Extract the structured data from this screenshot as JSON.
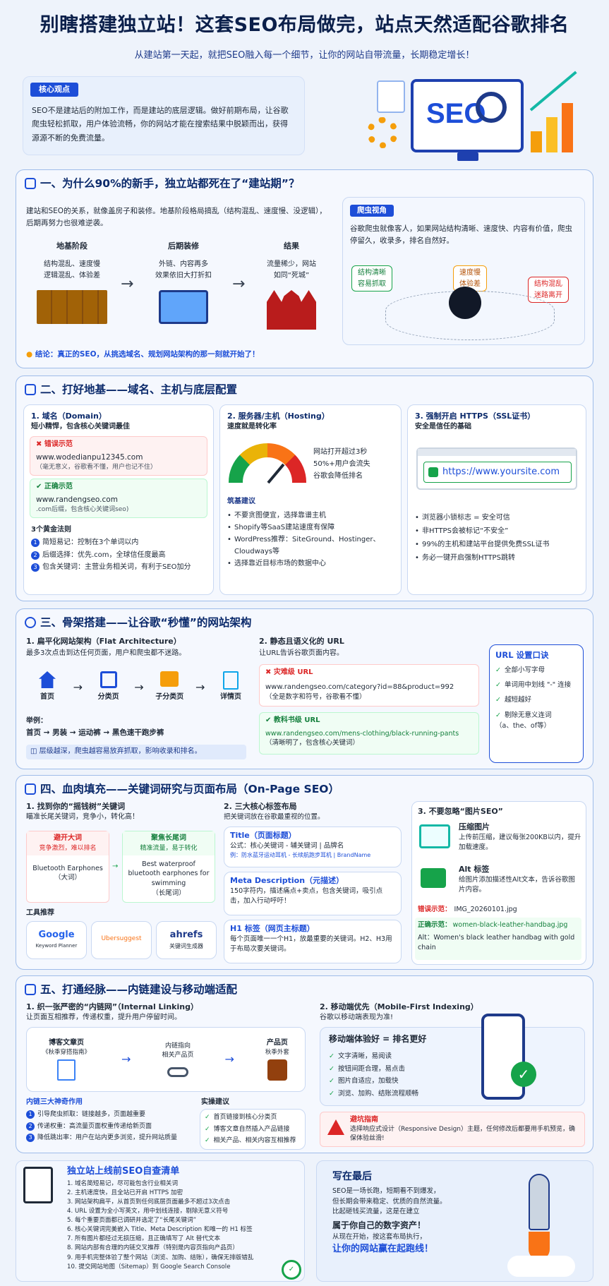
{
  "header": {
    "title": "别瞎搭建独立站！这套SEO布局做完，站点天然适配谷歌排名",
    "subtitle": "从建站第一天起，就把SEO融入每一个细节，让你的网站自带流量，长期稳定增长！"
  },
  "core": {
    "tag": "核心观点",
    "text": "SEO不是建站后的附加工作，而是建站的底层逻辑。做好前期布局，让谷歌爬虫轻松抓取，用户体验流畅，你的网站才能在搜索结果中脱颖而出，获得源源不断的免费流量。",
    "hero_text": "SEO"
  },
  "s1": {
    "title": "一、为什么90%的新手，独立站都死在了“建站期”？",
    "intro": "建站和SEO的关系，就像盖房子和装修。地基阶段格局搞乱（结构混乱、速度慢、没逻辑），后期再努力也很难逆袭。",
    "stages": [
      {
        "title": "地基阶段",
        "desc": "结构混乱、速度慢\n逻辑混乱、体验差"
      },
      {
        "title": "后期装修",
        "desc": "外链、内容再多\n效果依旧大打折扣"
      },
      {
        "title": "结果",
        "desc": "流量稀少，网站\n如同“死城”"
      }
    ],
    "crawler_tag": "爬虫视角",
    "crawler_text": "谷歌爬虫就像客人，如果网站结构清晰、速度快、内容有价值，爬虫停留久，收录多，排名自然好。",
    "bubbles": [
      "结构清晰\n容易抓取",
      "速度慢\n体验差",
      "结构混乱\n迷路离开"
    ],
    "conclusion": "结论：真正的SEO，从挑选域名、规划网站架构的那一刻就开始了！"
  },
  "s2": {
    "title": "二、打好地基——域名、主机与底层配置",
    "c1": {
      "title": "1. 域名（Domain）",
      "sub": "短小精悍，包含核心关键词最佳",
      "bad_label": "错误示范",
      "bad_url": "www.wodedianpu12345.com",
      "bad_note": "（毫无意义，谷歌看不懂，用户也记不住）",
      "good_label": "正确示范",
      "good_url": "www.randengseo.com",
      "good_note": ".com后缀，包含核心关键词seo)",
      "rules_title": "3个黄金法则",
      "rules": [
        "简短易记：控制在3个单词以内",
        "后缀选择：优先.com，全球信任度最高",
        "包含关键词：主营业务相关词，有利于SEO加分"
      ]
    },
    "c2": {
      "title": "2. 服务器/主机（Hosting）",
      "sub": "速度就是转化率",
      "gauge_text": "网站打开超过3秒\n50%+用户会流失\n谷歌会降低排名",
      "tips_title": "筑基建议",
      "tips": [
        "不要贪图便宜，选择靠谱主机",
        "Shopify等SaaS建站速度有保障",
        "WordPress推荐：SiteGround、Hostinger、Cloudways等",
        "选择靠近目标市场的数据中心"
      ]
    },
    "c3": {
      "title": "3. 强制开启 HTTPS（SSL证书）",
      "sub": "安全是信任的基础",
      "url": "https://www.yoursite.com",
      "tips": [
        "浏览器小锁标志 = 安全可信",
        "非HTTPS会被标记“不安全”",
        "99%的主机和建站平台提供免费SSL证书",
        "务必一键开启强制HTTPS跳转"
      ]
    }
  },
  "s3": {
    "title": "三、骨架搭建——让谷歌“秒懂”的网站架构",
    "c1": {
      "title": "1. 扁平化网站架构（Flat Architecture）",
      "sub": "最多3次点击到达任何页面，用户和爬虫都不迷路。",
      "nodes": [
        "首页",
        "分类页",
        "子分类页",
        "详情页"
      ],
      "example_label": "举例：",
      "example": [
        "首页",
        "男装",
        "运动裤",
        "黑色速干跑步裤"
      ],
      "note": "层级越深，爬虫越容易放弃抓取，影响收录和排名。"
    },
    "c2": {
      "title": "2. 静态且语义化的 URL",
      "sub": "让URL告诉谷歌页面内容。",
      "bad_label": "灾难级 URL",
      "bad_url": "www.randengseo.com/category?id=88&product=992",
      "bad_note": "（全是数字和符号，谷歌看不懂）",
      "good_label": "教科书级 URL",
      "good_url": "www.randengseo.com/mens-clothing/black-running-pants",
      "good_note": "（清晰明了，包含核心关键词）"
    },
    "c3": {
      "title": "URL 设置口诀",
      "items": [
        "全部小写字母",
        "单词用中划线 \"-\" 连接",
        "越短越好",
        "剔除无意义连词\n（a、the、of等）"
      ]
    }
  },
  "s4": {
    "title": "四、血肉填充——关键词研究与页面布局（On-Page SEO）",
    "c1": {
      "title": "1. 找到你的“摇钱树”关键词",
      "sub": "瞄准长尾关键词，竞争小，转化高！",
      "big": {
        "title": "避开大词",
        "sub": "竞争激烈，难以排名",
        "word": "Bluetooth Earphones",
        "tag": "（大词）"
      },
      "long": {
        "title": "聚焦长尾词",
        "sub": "精准流量，易于转化",
        "word": "Best waterproof bluetooth earphones for swimming",
        "tag": "（长尾词）"
      },
      "tools_title": "工具推荐",
      "tools": [
        {
          "name": "Google",
          "sub": "Keyword Planner"
        },
        {
          "name": "Ubersuggest",
          "sub": ""
        },
        {
          "name": "ahrefs",
          "sub": "关键词生成器"
        }
      ]
    },
    "c2": {
      "title": "2. 三大核心标签布局",
      "sub": "把关键词放在谷歌最重视的位置。",
      "tags": [
        {
          "title": "Title（页面标题）",
          "line1": "公式：核心关键词 - 辅关键词 | 品牌名",
          "line2": "例：防水蓝牙运动耳机 - 长续航跑步耳机 | BrandName"
        },
        {
          "title": "Meta Description（元描述）",
          "line1": "150字符内，描述痛点+卖点，包含关键词，吸引点击，加入行动呼吁！",
          "line2": ""
        },
        {
          "title": "H1 标签（网页主标题）",
          "line1": "每个页面唯一一个H1，放最重要的关键词。H2、H3用于布局次要关键词。",
          "line2": ""
        }
      ]
    },
    "c3": {
      "title": "3. 不要忽略“图片SEO”",
      "compress_title": "压缩图片",
      "compress_text": "上传前压缩，建议每张200KB以内，提升加载速度。",
      "alt_title": "Alt 标签",
      "alt_text": "给图片添加描述性Alt文本，告诉谷歌图片内容。",
      "bad_label": "错误示范：",
      "bad_file": "IMG_20260101.jpg",
      "good_label": "正确示范：",
      "good_file": "women-black-leather-handbag.jpg",
      "alt_example": "Alt：Women's black leather handbag with gold chain"
    }
  },
  "s5": {
    "title": "五、打通经脉——内链建设与移动端适配",
    "c1": {
      "title": "1. 织一张严密的“内链网”（Internal Linking）",
      "sub": "让页面互相推荐，传递权重，提升用户停留时间。",
      "nodes": [
        {
          "t": "博客文章页",
          "s": "《秋季穿搭指南》"
        },
        {
          "t": "内链指向",
          "s": "相关产品页"
        },
        {
          "t": "产品页",
          "s": "秋季外套"
        }
      ],
      "roles_title": "内链三大神奇作用",
      "roles": [
        "引导爬虫抓取：链接越多，页面越重要",
        "传递权重：高流量页面权重传递给新页面",
        "降低跳出率：用户在站内更多浏览，提升网站质量"
      ],
      "tips_title": "实操建议",
      "tips": [
        "首页链接到核心分类页",
        "博客文章自然插入产品链接",
        "相关产品、相关内容互相推荐"
      ]
    },
    "c2": {
      "title": "2. 移动端优先（Mobile-First Indexing）",
      "sub": "谷歌以移动端表现为准!",
      "motto": "移动端体验好 = 排名更好",
      "items": [
        "文字清晰，易阅读",
        "按钮间距合理，易点击",
        "图片自适应，加载快",
        "浏览、加购、结账流程顺畅"
      ],
      "warn_title": "避坑指南",
      "warn_text": "选择响应式设计（Responsive Design）主题，任何修改后都要用手机预览，确保体验丝滑!"
    }
  },
  "checklist": {
    "title": "独立站上线前SEO自查清单",
    "items": [
      "域名简短易记，尽可能包含行业相关词",
      "主机速度快，且全站已开启 HTTPS 加密",
      "网站架构扁平，从首页到任何底层页面最多不超过3次点击",
      "URL 设置为全小写英文，用中划线连接，剔除无意义符号",
      "每个重要页面都已调研并选定了“长尾关键词”",
      "核心关键词完美嵌入 Title、Meta Description 和唯一的 H1 标签",
      "所有图片都经过无损压缩，且正确填写了 Alt 替代文本",
      "网站内部有合理的内链交叉推荐（特别是内容页指向产品页）",
      "用手机完整体验了整个网站（浏览、加购、结账），确保无排版错乱",
      "提交网站地图（Sitemap）到 Google Search Console"
    ]
  },
  "final": {
    "title": "写在最后",
    "lines": [
      "SEO是一场长跑，短期看不到爆发，",
      "但长期会带来稳定、优质的自然流量。",
      "比起砸钱买流量，这是在建立"
    ],
    "bold": "属于你自己的数字资产！",
    "line2": "从现在开始，按这套布局执行，",
    "highlight": "让你的网站赢在起跑线！"
  },
  "colors": {
    "navy": "#0b2a6b",
    "blue": "#1d4ed8",
    "red": "#dc2626",
    "green": "#16a34a",
    "orange": "#f59e0b"
  }
}
